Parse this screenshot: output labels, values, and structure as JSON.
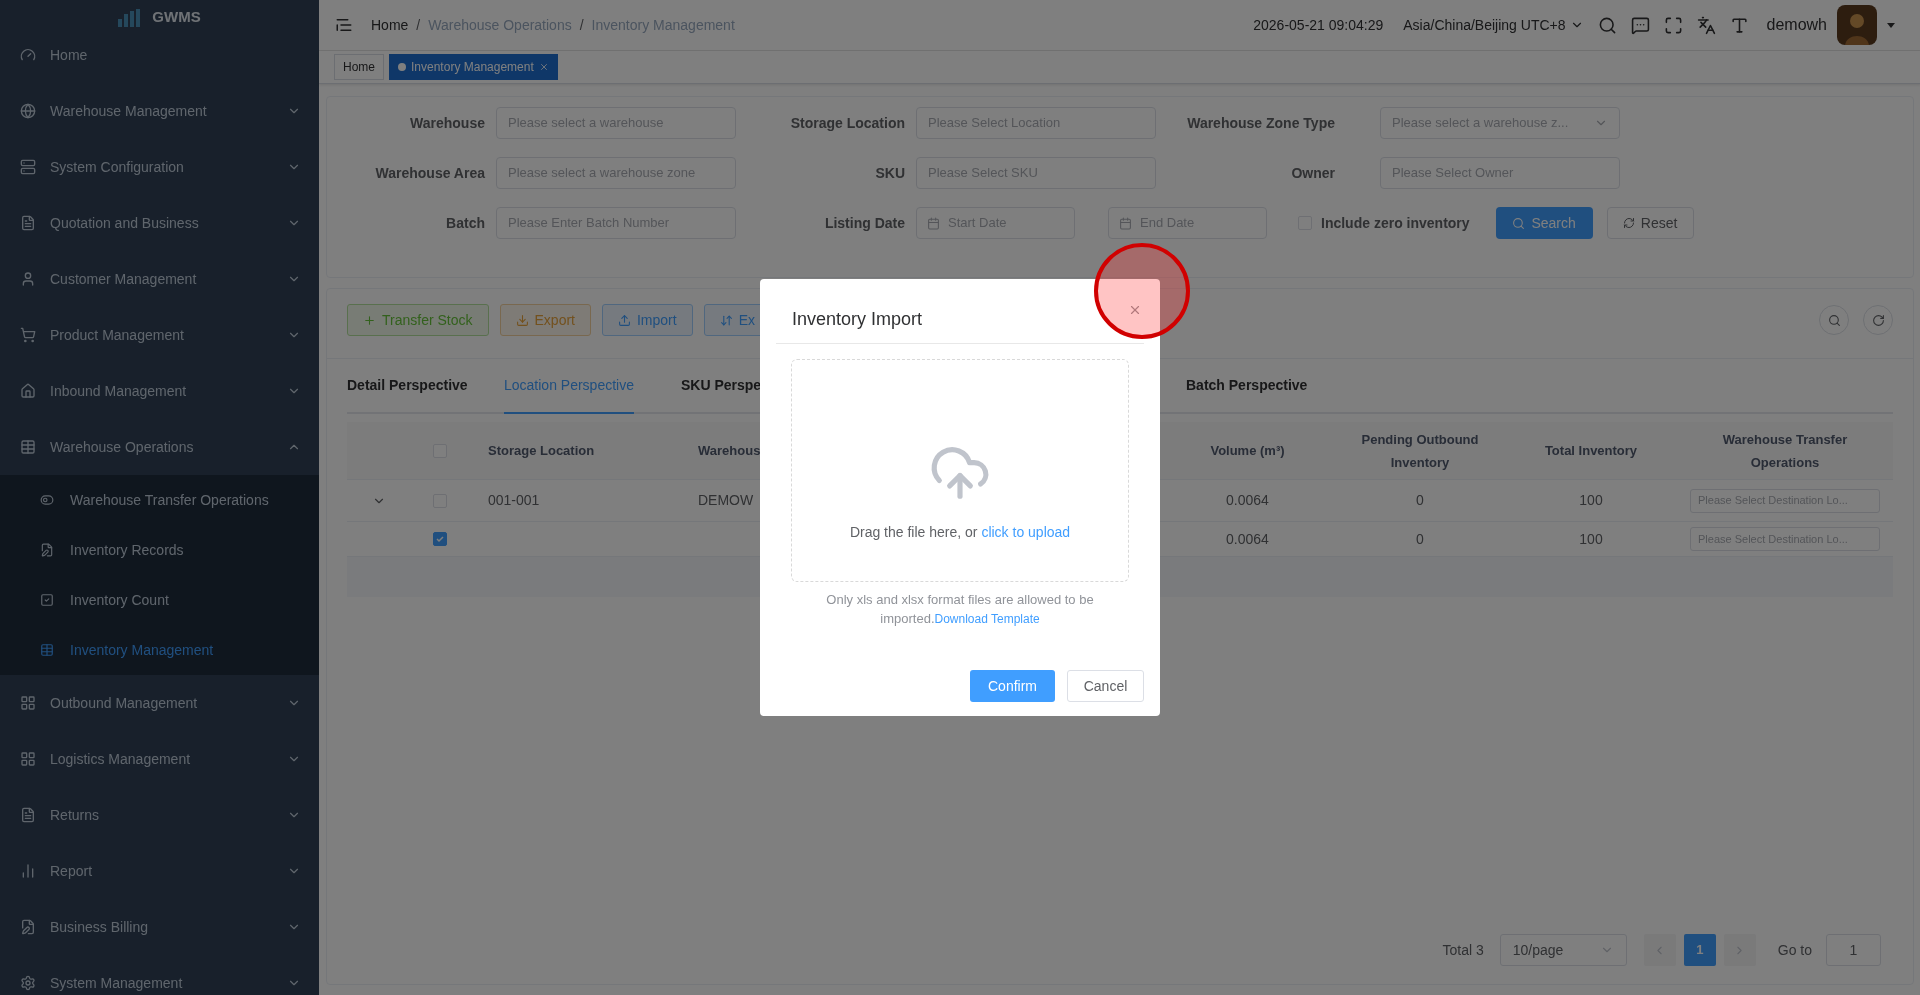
{
  "sidebar": {
    "logo": "GWMS",
    "items": [
      {
        "label": "Home"
      },
      {
        "label": "Warehouse Management",
        "expanded": false
      },
      {
        "label": "System Configuration",
        "expanded": false
      },
      {
        "label": "Quotation and Business",
        "expanded": false
      },
      {
        "label": "Customer Management",
        "expanded": false
      },
      {
        "label": "Product Management",
        "expanded": false
      },
      {
        "label": "Inbound Management",
        "expanded": false
      },
      {
        "label": "Warehouse Operations",
        "expanded": true,
        "children": [
          {
            "label": "Warehouse Transfer Operations",
            "selected": false
          },
          {
            "label": "Inventory Records",
            "selected": false
          },
          {
            "label": "Inventory Count",
            "selected": false
          },
          {
            "label": "Inventory Management",
            "selected": true
          }
        ]
      },
      {
        "label": "Outbound Management",
        "expanded": false
      },
      {
        "label": "Logistics Management",
        "expanded": false
      },
      {
        "label": "Returns",
        "expanded": false
      },
      {
        "label": "Report",
        "expanded": false
      },
      {
        "label": "Business Billing",
        "expanded": false
      },
      {
        "label": "System Management",
        "expanded": false
      }
    ]
  },
  "header": {
    "breadcrumb": [
      "Home",
      "Warehouse Operations",
      "Inventory Management"
    ],
    "separator": "/",
    "datetime": "2026-05-21 09:04:29",
    "timezone": "Asia/China/Beijing UTC+8",
    "user": "demowh"
  },
  "tags": [
    {
      "label": "Home",
      "selected": false
    },
    {
      "label": "Inventory Management",
      "selected": true
    }
  ],
  "filters": {
    "rows": [
      [
        {
          "kind": "text",
          "label": "Warehouse",
          "placeholder": "Please select a warehouse"
        },
        {
          "kind": "text",
          "label": "Storage Location",
          "placeholder": "Please Select Location"
        },
        {
          "kind": "select",
          "label": "Warehouse Zone Type",
          "placeholder": "Please select a warehouse z..."
        }
      ],
      [
        {
          "kind": "text",
          "label": "Warehouse Area",
          "placeholder": "Please select a warehouse zone"
        },
        {
          "kind": "text",
          "label": "SKU",
          "placeholder": "Please Select SKU"
        },
        {
          "kind": "text",
          "label": "Owner",
          "placeholder": "Please Select Owner"
        }
      ],
      [
        {
          "kind": "text",
          "label": "Batch",
          "placeholder": "Please Enter Batch Number"
        },
        {
          "kind": "daterange",
          "label": "Listing Date",
          "start_placeholder": "Start Date",
          "end_placeholder": "End Date"
        },
        {
          "kind": "checkbox",
          "label": "Include zero inventory",
          "checked": false
        }
      ]
    ],
    "search": "Search",
    "reset": "Reset"
  },
  "toolbar": [
    {
      "kind": "success",
      "label": "Transfer Stock"
    },
    {
      "kind": "warning",
      "label": "Export"
    },
    {
      "kind": "primary",
      "label": "Import"
    },
    {
      "kind": "primary",
      "label": "Ex"
    }
  ],
  "tabs": [
    {
      "label": "Detail Perspective",
      "selected": false
    },
    {
      "label": "Location Perspective",
      "selected": true
    },
    {
      "label": "SKU Perspe",
      "selected": false
    },
    {
      "label": "Batch Perspective",
      "selected": false
    }
  ],
  "table": {
    "header_checked": false,
    "columns": [
      "Storage Location",
      "Warehous",
      "Volume (m³)",
      "Pending Outbound Inventory",
      "Total Inventory",
      "Warehouse Transfer Operations"
    ],
    "rows": [
      {
        "expanded": false,
        "checked": false,
        "location": "001-001",
        "warehouse": "DEMOW",
        "volume": "0.0064",
        "pending": "0",
        "total": "100",
        "transfer_placeholder": "Please Select Destination Lo..."
      },
      {
        "checked": true,
        "volume": "0.0064",
        "pending": "0",
        "total": "100",
        "transfer_placeholder": "Please Select Destination Lo..."
      }
    ]
  },
  "pagination": {
    "total": "Total 3",
    "page_size": "10/page",
    "pages": [
      {
        "label": "1",
        "selected": true
      }
    ],
    "goto_label": "Go to",
    "goto_value": "1"
  },
  "modal": {
    "title": "Inventory Import",
    "drop_text": "Drag the file here, or ",
    "upload_link": "click to upload",
    "hint": "Only xls and xlsx format files are allowed to be imported.",
    "template_link": "Download Template",
    "confirm": "Confirm",
    "cancel": "Cancel"
  }
}
